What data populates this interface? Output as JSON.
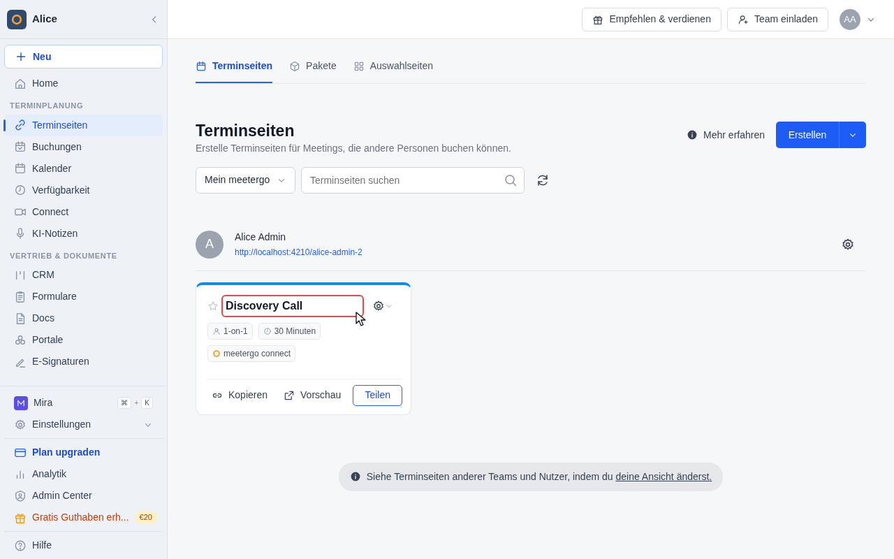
{
  "sidebar": {
    "workspace": "Alice",
    "new_button": "Neu",
    "sections": [
      {
        "items": [
          {
            "label": "Home",
            "selected": false
          }
        ]
      },
      {
        "heading": "TERMINPLANUNG",
        "items": [
          {
            "label": "Terminseiten",
            "selected": true
          },
          {
            "label": "Buchungen",
            "selected": false
          },
          {
            "label": "Kalender",
            "selected": false
          },
          {
            "label": "Verfügbarkeit",
            "selected": false
          },
          {
            "label": "Connect",
            "selected": false
          },
          {
            "label": "KI-Notizen",
            "selected": false
          }
        ]
      },
      {
        "heading": "VERTRIEB & DOKUMENTE",
        "items": [
          {
            "label": "CRM",
            "selected": false
          },
          {
            "label": "Formulare",
            "selected": false
          },
          {
            "label": "Docs",
            "selected": false
          },
          {
            "label": "Portale",
            "selected": false
          },
          {
            "label": "E-Signaturen",
            "selected": false
          }
        ]
      }
    ],
    "assistant": {
      "label": "Mira",
      "shortcut": [
        "⌘",
        "+",
        "K"
      ]
    },
    "settings": {
      "label": "Einstellungen",
      "expanded": false
    },
    "footer": [
      {
        "label": "Plan upgraden",
        "kind": "upgrade"
      },
      {
        "label": "Analytik",
        "kind": "plain"
      },
      {
        "label": "Admin Center",
        "kind": "plain"
      },
      {
        "label": "Gratis Guthaben erh...",
        "kind": "promo",
        "badge": "€20"
      }
    ],
    "help": "Hilfe"
  },
  "topbar": {
    "buttons": [
      "Empfehlen & verdienen",
      "Team einladen"
    ],
    "avatar": "AA"
  },
  "tabs": [
    {
      "label": "Terminseiten",
      "selected": true
    },
    {
      "label": "Pakete",
      "selected": false
    },
    {
      "label": "Auswahlseiten",
      "selected": false
    }
  ],
  "page": {
    "title": "Terminseiten",
    "subtitle": "Erstelle Terminseiten für Meetings, die andere Personen buchen können.",
    "learn_more": "Mehr erfahren",
    "create_button": "Erstellen"
  },
  "filters": {
    "scope": "Mein meetergo",
    "search": {
      "placeholder": "Terminseiten suchen"
    }
  },
  "user": {
    "initial": "A",
    "name": "Alice Admin",
    "url": "http://localhost:4210/alice-admin-2"
  },
  "cards": [
    {
      "title": "Discovery Call",
      "favorite": false,
      "title_highlighted": true,
      "tags": [
        {
          "text": "1-on-1",
          "kind": "person"
        },
        {
          "text": "30 Minuten",
          "kind": "duration"
        },
        {
          "text": "meetergo connect",
          "kind": "location"
        }
      ],
      "actions": {
        "copy": "Kopieren",
        "preview": "Vorschau",
        "share": "Teilen"
      }
    }
  ],
  "info": {
    "text": "Siehe Terminseiten anderer Teams und Nutzer, indem du",
    "link": "deine Ansicht änderst."
  }
}
